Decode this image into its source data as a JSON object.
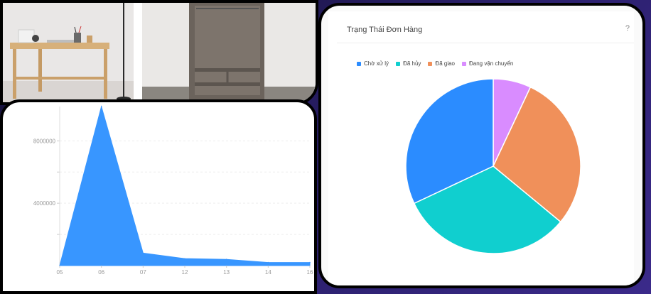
{
  "pie_widget": {
    "title": "Trạng Thái Đơn Hàng",
    "help_symbol": "?"
  },
  "colors": {
    "blue": "#2b8cff",
    "teal": "#10cfcf",
    "orange": "#f0905a",
    "violet": "#d98cff",
    "area": "#3896ff"
  },
  "chart_data": [
    {
      "type": "pie",
      "series": [
        {
          "name": "Chờ xử lý",
          "value": 32,
          "color": "#2b8cff"
        },
        {
          "name": "Đã hủy",
          "value": 32,
          "color": "#10cfcf"
        },
        {
          "name": "Đã giao",
          "value": 29,
          "color": "#f0905a"
        },
        {
          "name": "Đang vận chuyển",
          "value": 7,
          "color": "#d98cff"
        }
      ],
      "slice_order": [
        "Đang vận chuyển",
        "Đã giao",
        "Đã hủy",
        "Chờ xử lý"
      ],
      "legend_position": "top-left"
    },
    {
      "type": "area",
      "categories": [
        "05",
        "06",
        "07",
        "12",
        "13",
        "14",
        "16"
      ],
      "values": [
        0,
        10200000,
        800000,
        450000,
        400000,
        200000,
        200000
      ],
      "yticks": [
        4000000,
        8000000
      ],
      "ylim": [
        0,
        10200000
      ],
      "grid": true,
      "color": "#3896ff"
    }
  ]
}
